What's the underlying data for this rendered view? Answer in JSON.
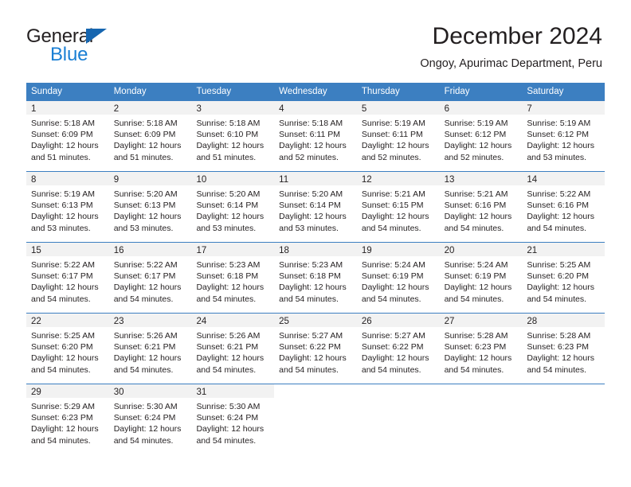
{
  "brand": {
    "name_top": "General",
    "name_bottom": "Blue",
    "triangle_color": "#1666b0",
    "blue_color": "#1a7fd4"
  },
  "header": {
    "title": "December 2024",
    "subtitle": "Ongoy, Apurimac Department, Peru"
  },
  "theme": {
    "header_blue": "#3c7fc1",
    "day_band_gray": "#f2f2f2",
    "text": "#231f20"
  },
  "weekdays": [
    "Sunday",
    "Monday",
    "Tuesday",
    "Wednesday",
    "Thursday",
    "Friday",
    "Saturday"
  ],
  "weeks": [
    [
      {
        "day": "1",
        "sunrise": "Sunrise: 5:18 AM",
        "sunset": "Sunset: 6:09 PM",
        "daylight1": "Daylight: 12 hours",
        "daylight2": "and 51 minutes."
      },
      {
        "day": "2",
        "sunrise": "Sunrise: 5:18 AM",
        "sunset": "Sunset: 6:09 PM",
        "daylight1": "Daylight: 12 hours",
        "daylight2": "and 51 minutes."
      },
      {
        "day": "3",
        "sunrise": "Sunrise: 5:18 AM",
        "sunset": "Sunset: 6:10 PM",
        "daylight1": "Daylight: 12 hours",
        "daylight2": "and 51 minutes."
      },
      {
        "day": "4",
        "sunrise": "Sunrise: 5:18 AM",
        "sunset": "Sunset: 6:11 PM",
        "daylight1": "Daylight: 12 hours",
        "daylight2": "and 52 minutes."
      },
      {
        "day": "5",
        "sunrise": "Sunrise: 5:19 AM",
        "sunset": "Sunset: 6:11 PM",
        "daylight1": "Daylight: 12 hours",
        "daylight2": "and 52 minutes."
      },
      {
        "day": "6",
        "sunrise": "Sunrise: 5:19 AM",
        "sunset": "Sunset: 6:12 PM",
        "daylight1": "Daylight: 12 hours",
        "daylight2": "and 52 minutes."
      },
      {
        "day": "7",
        "sunrise": "Sunrise: 5:19 AM",
        "sunset": "Sunset: 6:12 PM",
        "daylight1": "Daylight: 12 hours",
        "daylight2": "and 53 minutes."
      }
    ],
    [
      {
        "day": "8",
        "sunrise": "Sunrise: 5:19 AM",
        "sunset": "Sunset: 6:13 PM",
        "daylight1": "Daylight: 12 hours",
        "daylight2": "and 53 minutes."
      },
      {
        "day": "9",
        "sunrise": "Sunrise: 5:20 AM",
        "sunset": "Sunset: 6:13 PM",
        "daylight1": "Daylight: 12 hours",
        "daylight2": "and 53 minutes."
      },
      {
        "day": "10",
        "sunrise": "Sunrise: 5:20 AM",
        "sunset": "Sunset: 6:14 PM",
        "daylight1": "Daylight: 12 hours",
        "daylight2": "and 53 minutes."
      },
      {
        "day": "11",
        "sunrise": "Sunrise: 5:20 AM",
        "sunset": "Sunset: 6:14 PM",
        "daylight1": "Daylight: 12 hours",
        "daylight2": "and 53 minutes."
      },
      {
        "day": "12",
        "sunrise": "Sunrise: 5:21 AM",
        "sunset": "Sunset: 6:15 PM",
        "daylight1": "Daylight: 12 hours",
        "daylight2": "and 54 minutes."
      },
      {
        "day": "13",
        "sunrise": "Sunrise: 5:21 AM",
        "sunset": "Sunset: 6:16 PM",
        "daylight1": "Daylight: 12 hours",
        "daylight2": "and 54 minutes."
      },
      {
        "day": "14",
        "sunrise": "Sunrise: 5:22 AM",
        "sunset": "Sunset: 6:16 PM",
        "daylight1": "Daylight: 12 hours",
        "daylight2": "and 54 minutes."
      }
    ],
    [
      {
        "day": "15",
        "sunrise": "Sunrise: 5:22 AM",
        "sunset": "Sunset: 6:17 PM",
        "daylight1": "Daylight: 12 hours",
        "daylight2": "and 54 minutes."
      },
      {
        "day": "16",
        "sunrise": "Sunrise: 5:22 AM",
        "sunset": "Sunset: 6:17 PM",
        "daylight1": "Daylight: 12 hours",
        "daylight2": "and 54 minutes."
      },
      {
        "day": "17",
        "sunrise": "Sunrise: 5:23 AM",
        "sunset": "Sunset: 6:18 PM",
        "daylight1": "Daylight: 12 hours",
        "daylight2": "and 54 minutes."
      },
      {
        "day": "18",
        "sunrise": "Sunrise: 5:23 AM",
        "sunset": "Sunset: 6:18 PM",
        "daylight1": "Daylight: 12 hours",
        "daylight2": "and 54 minutes."
      },
      {
        "day": "19",
        "sunrise": "Sunrise: 5:24 AM",
        "sunset": "Sunset: 6:19 PM",
        "daylight1": "Daylight: 12 hours",
        "daylight2": "and 54 minutes."
      },
      {
        "day": "20",
        "sunrise": "Sunrise: 5:24 AM",
        "sunset": "Sunset: 6:19 PM",
        "daylight1": "Daylight: 12 hours",
        "daylight2": "and 54 minutes."
      },
      {
        "day": "21",
        "sunrise": "Sunrise: 5:25 AM",
        "sunset": "Sunset: 6:20 PM",
        "daylight1": "Daylight: 12 hours",
        "daylight2": "and 54 minutes."
      }
    ],
    [
      {
        "day": "22",
        "sunrise": "Sunrise: 5:25 AM",
        "sunset": "Sunset: 6:20 PM",
        "daylight1": "Daylight: 12 hours",
        "daylight2": "and 54 minutes."
      },
      {
        "day": "23",
        "sunrise": "Sunrise: 5:26 AM",
        "sunset": "Sunset: 6:21 PM",
        "daylight1": "Daylight: 12 hours",
        "daylight2": "and 54 minutes."
      },
      {
        "day": "24",
        "sunrise": "Sunrise: 5:26 AM",
        "sunset": "Sunset: 6:21 PM",
        "daylight1": "Daylight: 12 hours",
        "daylight2": "and 54 minutes."
      },
      {
        "day": "25",
        "sunrise": "Sunrise: 5:27 AM",
        "sunset": "Sunset: 6:22 PM",
        "daylight1": "Daylight: 12 hours",
        "daylight2": "and 54 minutes."
      },
      {
        "day": "26",
        "sunrise": "Sunrise: 5:27 AM",
        "sunset": "Sunset: 6:22 PM",
        "daylight1": "Daylight: 12 hours",
        "daylight2": "and 54 minutes."
      },
      {
        "day": "27",
        "sunrise": "Sunrise: 5:28 AM",
        "sunset": "Sunset: 6:23 PM",
        "daylight1": "Daylight: 12 hours",
        "daylight2": "and 54 minutes."
      },
      {
        "day": "28",
        "sunrise": "Sunrise: 5:28 AM",
        "sunset": "Sunset: 6:23 PM",
        "daylight1": "Daylight: 12 hours",
        "daylight2": "and 54 minutes."
      }
    ],
    [
      {
        "day": "29",
        "sunrise": "Sunrise: 5:29 AM",
        "sunset": "Sunset: 6:23 PM",
        "daylight1": "Daylight: 12 hours",
        "daylight2": "and 54 minutes."
      },
      {
        "day": "30",
        "sunrise": "Sunrise: 5:30 AM",
        "sunset": "Sunset: 6:24 PM",
        "daylight1": "Daylight: 12 hours",
        "daylight2": "and 54 minutes."
      },
      {
        "day": "31",
        "sunrise": "Sunrise: 5:30 AM",
        "sunset": "Sunset: 6:24 PM",
        "daylight1": "Daylight: 12 hours",
        "daylight2": "and 54 minutes."
      },
      {
        "day": "",
        "sunrise": "",
        "sunset": "",
        "daylight1": "",
        "daylight2": ""
      },
      {
        "day": "",
        "sunrise": "",
        "sunset": "",
        "daylight1": "",
        "daylight2": ""
      },
      {
        "day": "",
        "sunrise": "",
        "sunset": "",
        "daylight1": "",
        "daylight2": ""
      },
      {
        "day": "",
        "sunrise": "",
        "sunset": "",
        "daylight1": "",
        "daylight2": ""
      }
    ]
  ]
}
